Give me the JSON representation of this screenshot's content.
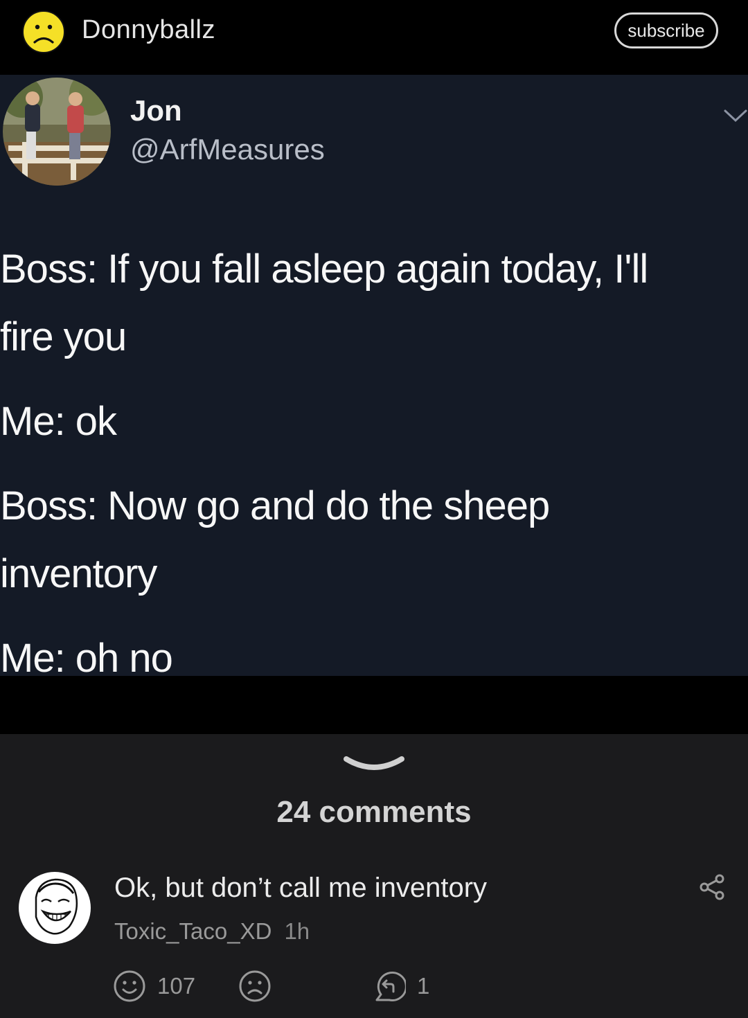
{
  "header": {
    "author": "Donnyballz",
    "avatar_icon": "sad-face-icon",
    "subscribe_label": "subscribe"
  },
  "tweet": {
    "name": "Jon",
    "handle": "@ArfMeasures",
    "lines": [
      [
        "Boss: If you fall asleep again today, I'll",
        "fire you"
      ],
      [
        "Me: ok"
      ],
      [
        "Boss: Now go and do the sheep",
        "inventory"
      ],
      [
        "Me: oh no"
      ]
    ]
  },
  "comments": {
    "count_label": "24 comments",
    "items": [
      {
        "text": "Ok, but don’t call me inventory",
        "author": "Toxic_Taco_XD",
        "time": "1h",
        "likes": "107",
        "replies": "1"
      }
    ]
  },
  "colors": {
    "tweet_bg": "#141a26",
    "comments_bg": "#1b1b1d",
    "avatar_yellow": "#f5e027"
  }
}
